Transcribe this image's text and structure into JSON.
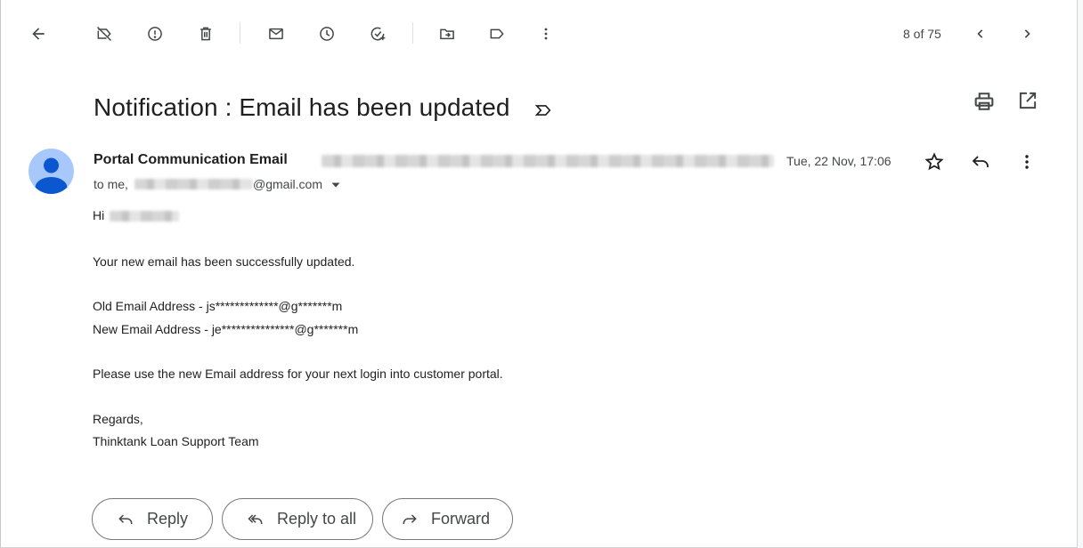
{
  "toolbar": {
    "page_count": "8 of 75",
    "icons": [
      "back-arrow-icon",
      "label-off-icon",
      "report-spam-icon",
      "delete-icon",
      "mark-unread-icon",
      "snooze-icon",
      "add-task-icon",
      "move-to-icon",
      "label-icon",
      "more-vert-icon",
      "chevron-left-icon",
      "chevron-right-icon"
    ]
  },
  "message": {
    "subject": "Notification : Email has been updated",
    "sender_name": "Portal Communication Email",
    "date": "Tue, 22 Nov, 17:06",
    "to_prefix": "to me,",
    "to_domain": "@gmail.com",
    "greeting": "Hi",
    "body": [
      "Your new email has been successfully updated.",
      "Old Email Address - js*************@g*******m",
      "New Email Address - je***************@g*******m",
      "Please use the new Email address for your next login into customer portal.",
      "Regards,",
      "Thinktank Loan Support Team"
    ]
  },
  "actions": {
    "reply": "Reply",
    "reply_all": "Reply to all",
    "forward": "Forward"
  },
  "colors": {
    "avatar_bg": "#a8c7fa",
    "avatar_fg": "#0b57d0",
    "text_primary": "#1f1f1f",
    "text_secondary": "#444746"
  }
}
